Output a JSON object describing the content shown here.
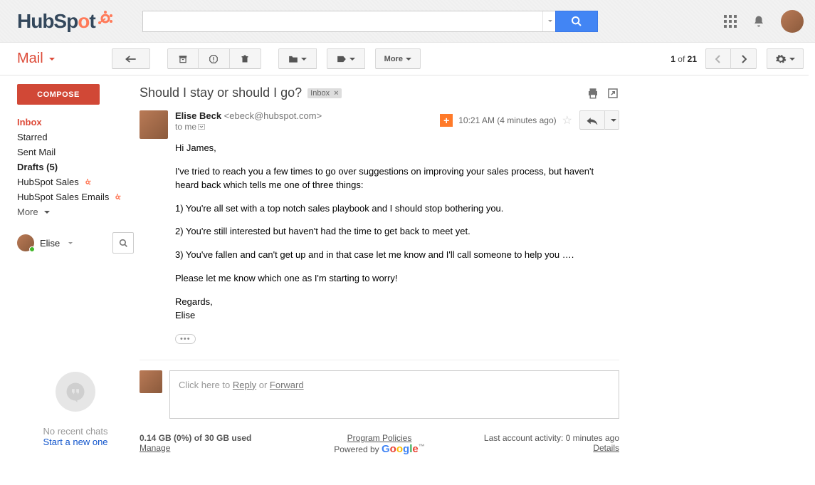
{
  "logo": {
    "text1": "HubSp",
    "text2": "t"
  },
  "search": {
    "placeholder": ""
  },
  "mail_label": "Mail",
  "toolbar": {
    "more": "More"
  },
  "pagination": {
    "pos": "1",
    "of_word": "of",
    "total": "21"
  },
  "sidebar": {
    "compose": "COMPOSE",
    "items": [
      {
        "label": "Inbox",
        "cls": "inbox"
      },
      {
        "label": "Starred",
        "cls": ""
      },
      {
        "label": "Sent Mail",
        "cls": ""
      },
      {
        "label": "Drafts (5)",
        "cls": "bold"
      },
      {
        "label": "HubSpot Sales",
        "cls": "",
        "hs": true
      },
      {
        "label": "HubSpot Sales Emails",
        "cls": "",
        "hs": true
      }
    ],
    "more": "More",
    "self_name": "Elise"
  },
  "hangouts": {
    "line1": "No recent chats",
    "line2": "Start a new one"
  },
  "email": {
    "subject": "Should I stay or should I go?",
    "label_chip": "Inbox",
    "from_name": "Elise Beck",
    "from_email": "<ebeck@hubspot.com>",
    "to": "to me",
    "date": "10:21 AM (4 minutes ago)",
    "paragraphs": [
      "Hi James,",
      "I've tried to reach you a few times to go over suggestions on improving your sales process, but haven't heard back which tells me one of three things:",
      "1) You're all set with a top notch sales playbook and I should stop bothering you.",
      "2) You're still interested but haven't had the time to get back to meet yet.",
      "3) You've fallen and can't get up and in that case let me know and I'll call someone to help you ….",
      "Please let me know which one as I'm starting to worry!",
      "Regards,\nElise"
    ]
  },
  "reply_box": {
    "pre": "Click here to ",
    "reply": "Reply",
    "or": " or ",
    "forward": "Forward"
  },
  "footer": {
    "storage": "0.14 GB (0%) of 30 GB used",
    "manage": "Manage",
    "policies": "Program Policies",
    "powered": "Powered by ",
    "activity": "Last account activity: 0 minutes ago",
    "details": "Details"
  }
}
